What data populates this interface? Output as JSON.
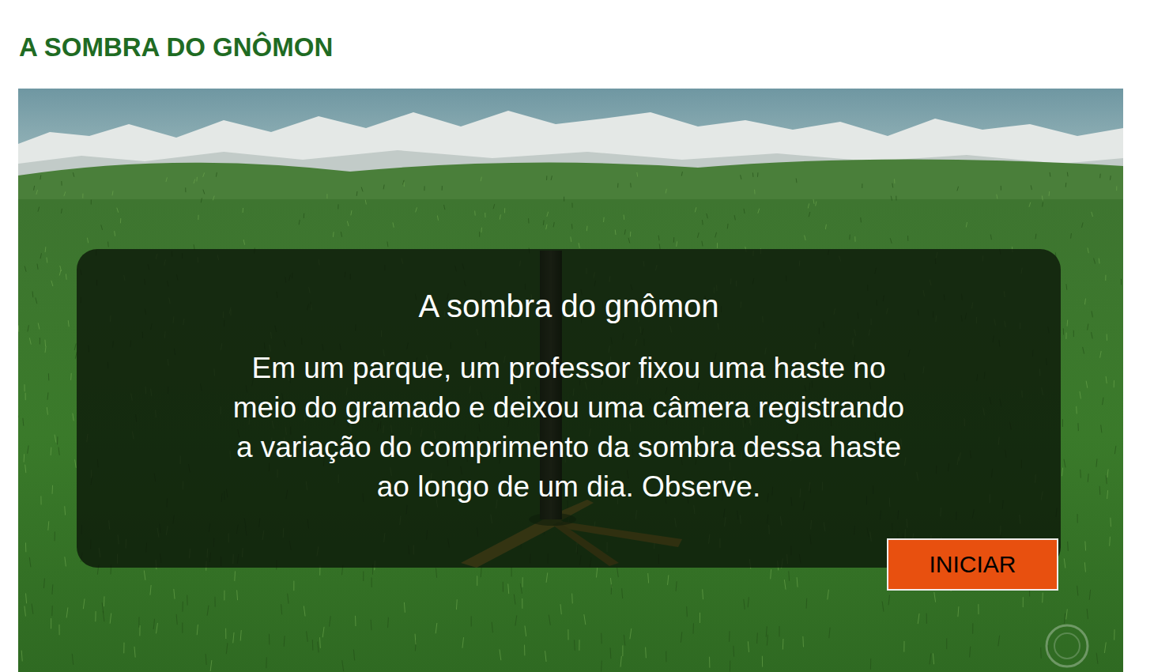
{
  "page": {
    "title": "A SOMBRA DO GNÔMON"
  },
  "intro": {
    "title": "A sombra do gnômon",
    "lines": [
      "Em um parque, um professor fixou uma haste no",
      "meio do gramado e deixou uma câmera registrando",
      "a variação do comprimento da sombra dessa haste",
      "ao longo de um dia. Observe."
    ]
  },
  "buttons": [
    "INICIAR"
  ]
}
